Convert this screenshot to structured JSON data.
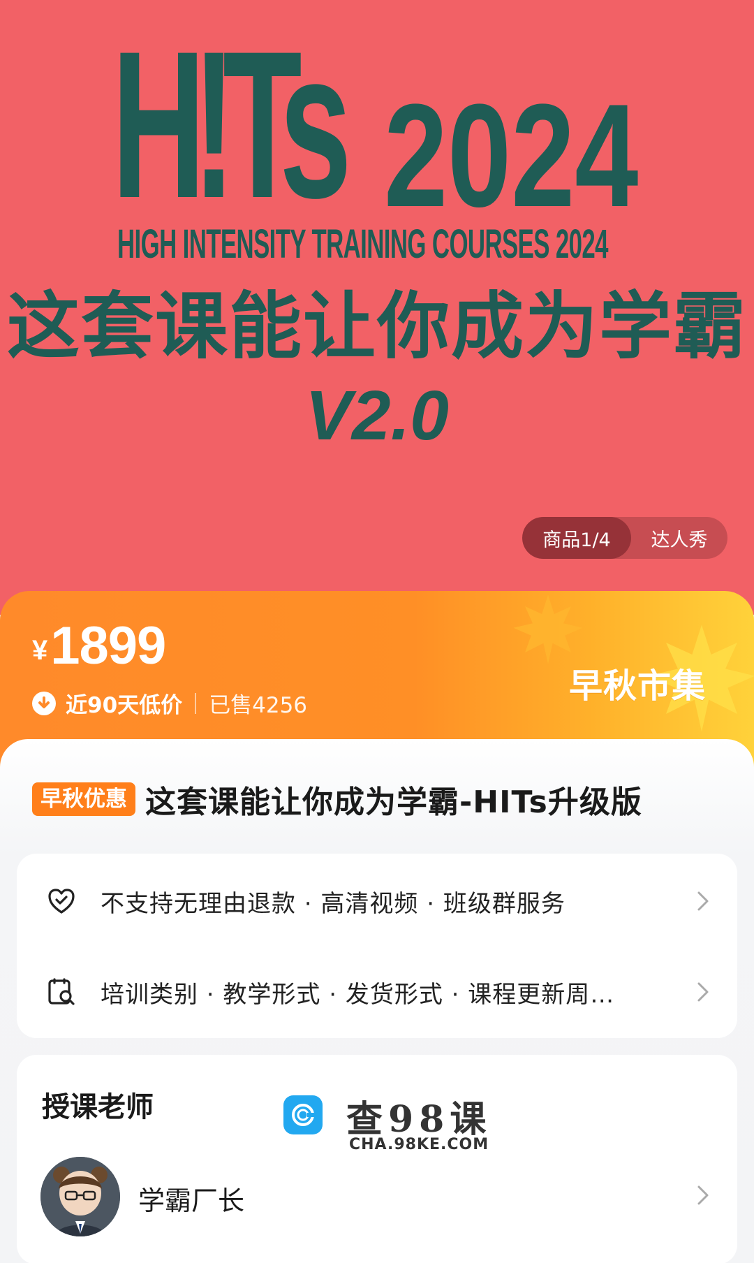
{
  "banner": {
    "hits_word": "H!Ts",
    "hits_year": "2024",
    "hits_subtitle": "HIGH INTENSITY TRAINING COURSES 2024",
    "headline_cn": "这套课能让你成为学霸",
    "version": "V2.0",
    "bg_color": "#f26166",
    "text_color": "#1f5c55"
  },
  "gallery_pager": {
    "active_label": "商品1/4",
    "other_label": "达人秀"
  },
  "price_band": {
    "currency": "¥",
    "price": "1899",
    "low_price_label": "近90天低价",
    "sold_label": "已售4256",
    "promo_title": "早秋市集",
    "accent_color": "#ff8a2a"
  },
  "product": {
    "tag": "早秋优惠",
    "title": "这套课能让你成为学霸-HITs升级版"
  },
  "info_rows": [
    {
      "icon": "heart-shield-icon",
      "text": "不支持无理由退款 · 高清视频 · 班级群服务"
    },
    {
      "icon": "params-search-icon",
      "text": "培训类别 · 教学形式 · 发货形式 · 课程更新周…"
    }
  ],
  "teacher": {
    "heading": "授课老师",
    "name": "学霸厂长"
  },
  "watermark": {
    "title": "查98课",
    "url": "CHA.98KE.COM"
  }
}
